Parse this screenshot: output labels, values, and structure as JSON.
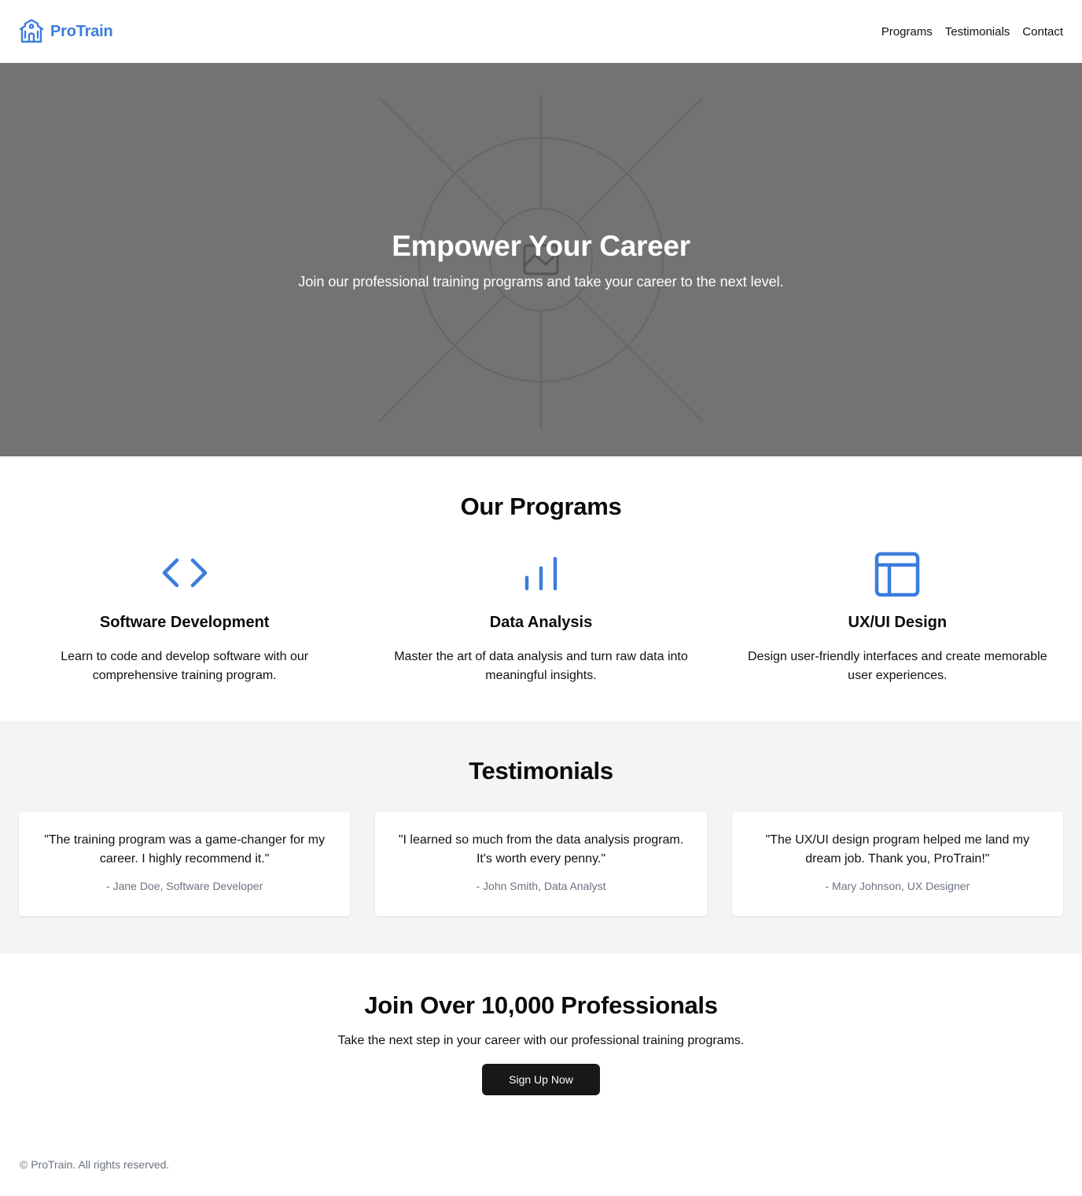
{
  "header": {
    "brand_name": "ProTrain",
    "brand_icon": "school-building-icon",
    "nav": [
      {
        "label": "Programs"
      },
      {
        "label": "Testimonials"
      },
      {
        "label": "Contact"
      }
    ]
  },
  "hero": {
    "title": "Empower Your Career",
    "subtitle": "Join our professional training programs and take your career to the next level.",
    "background_icon": "image-placeholder-icon"
  },
  "programs": {
    "title": "Our Programs",
    "items": [
      {
        "icon": "code-icon",
        "title": "Software Development",
        "description": "Learn to code and develop software with our comprehensive training program."
      },
      {
        "icon": "bar-chart-icon",
        "title": "Data Analysis",
        "description": "Master the art of data analysis and turn raw data into meaningful insights."
      },
      {
        "icon": "layout-icon",
        "title": "UX/UI Design",
        "description": "Design user-friendly interfaces and create memorable user experiences."
      }
    ]
  },
  "testimonials": {
    "title": "Testimonials",
    "items": [
      {
        "quote": "\"The training program was a game-changer for my career. I highly recommend it.\"",
        "author": "- Jane Doe, Software Developer"
      },
      {
        "quote": "\"I learned so much from the data analysis program. It's worth every penny.\"",
        "author": "- John Smith, Data Analyst"
      },
      {
        "quote": "\"The UX/UI design program helped me land my dream job. Thank you, ProTrain!\"",
        "author": "- Mary Johnson, UX Designer"
      }
    ]
  },
  "cta": {
    "title": "Join Over 10,000 Professionals",
    "subtitle": "Take the next step in your career with our professional training programs.",
    "button_label": "Sign Up Now"
  },
  "footer": {
    "text": "© ProTrain. All rights reserved."
  },
  "colors": {
    "brand": "#3b7ddd",
    "hero_bg": "#737373",
    "testimonials_bg": "#f3f4f6",
    "button_bg": "#18181b"
  }
}
